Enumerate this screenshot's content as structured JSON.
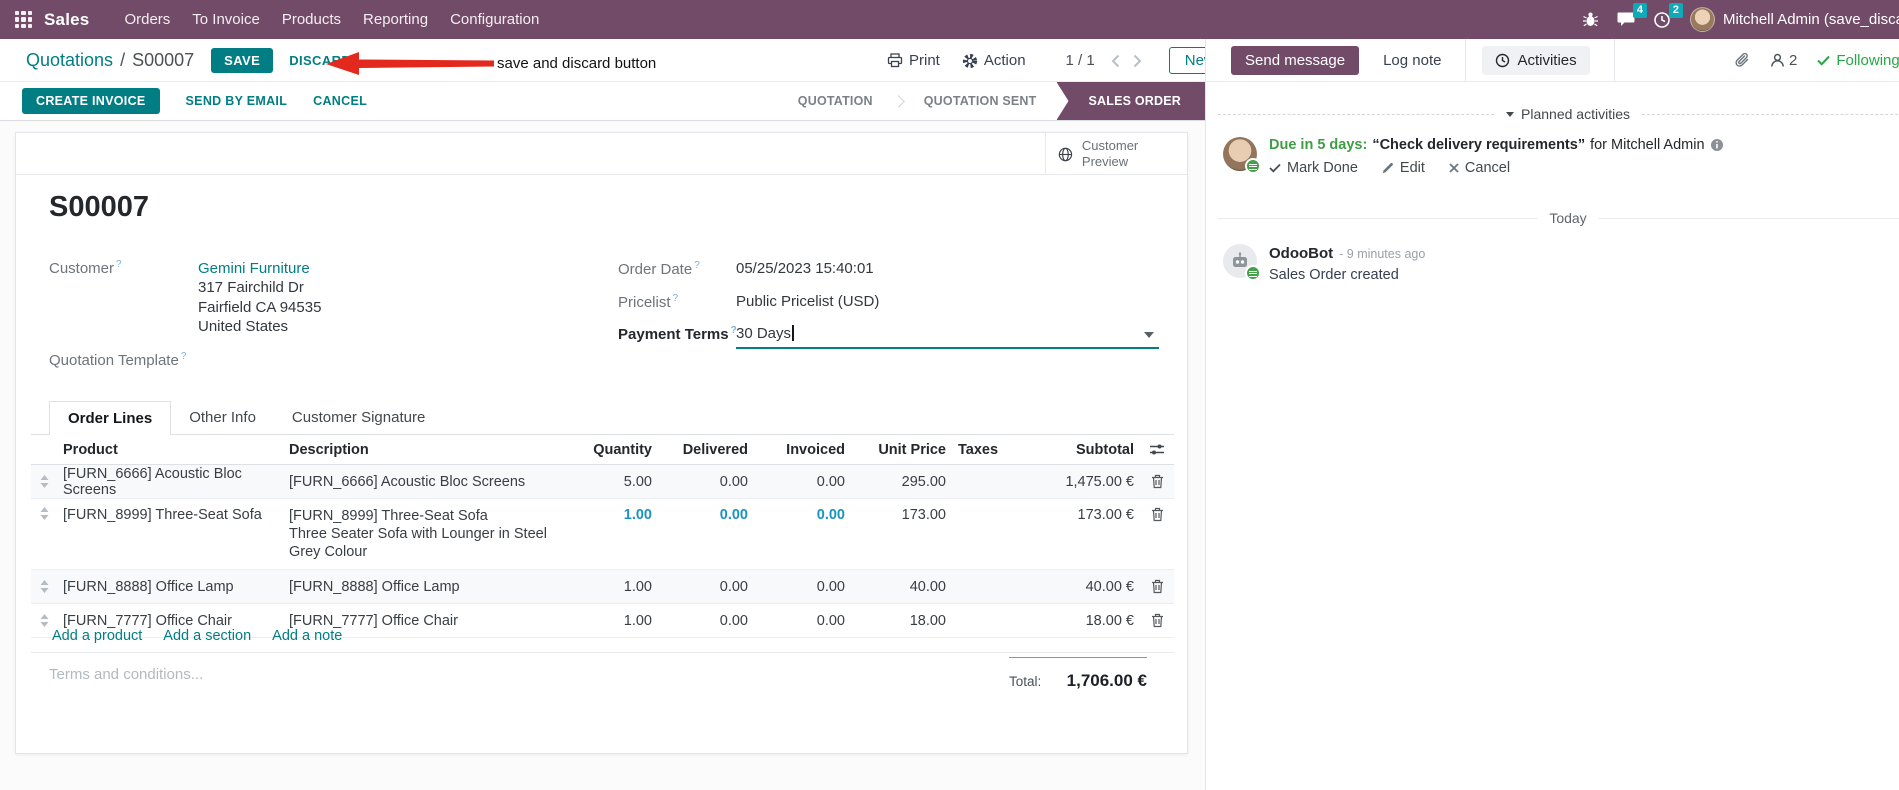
{
  "colors": {
    "brand": "#714B67",
    "accent": "#017E84",
    "badge": "#0dabb8",
    "green": "#28a745",
    "modified": "#1a93c1",
    "annotation_red": "#e3291d"
  },
  "topnav": {
    "app_label": "Sales",
    "menus": [
      "Orders",
      "To Invoice",
      "Products",
      "Reporting",
      "Configuration"
    ],
    "chat_badge": "4",
    "clock_badge": "2",
    "user_name": "Mitchell Admin (save_discard"
  },
  "breadcrumb": {
    "parent": "Quotations",
    "separator": "/",
    "current": "S00007",
    "save": "SAVE",
    "discard": "DISCARD",
    "annotation": "save and discard button",
    "print": "Print",
    "action": "Action",
    "pager": "1 / 1",
    "new": "New"
  },
  "statusbar": {
    "create_invoice": "CREATE INVOICE",
    "send_by_email": "SEND BY EMAIL",
    "cancel": "CANCEL",
    "stages": [
      "QUOTATION",
      "QUOTATION SENT",
      "SALES ORDER"
    ]
  },
  "sheet": {
    "customer_preview": "Customer Preview",
    "title": "S00007",
    "customer_label": "Customer",
    "customer_name": "Gemini Furniture",
    "address_line1": "317 Fairchild Dr",
    "address_line2": "Fairfield CA 94535",
    "address_line3": "United States",
    "quotation_template_label": "Quotation Template",
    "order_date_label": "Order Date",
    "order_date_value": "05/25/2023 15:40:01",
    "pricelist_label": "Pricelist",
    "pricelist_value": "Public Pricelist (USD)",
    "payment_terms_label": "Payment Terms",
    "payment_terms_value": "30 Days",
    "tabs": [
      "Order Lines",
      "Other Info",
      "Customer Signature"
    ],
    "table": {
      "columns": {
        "product": "Product",
        "description": "Description",
        "quantity": "Quantity",
        "delivered": "Delivered",
        "invoiced": "Invoiced",
        "unit_price": "Unit Price",
        "taxes": "Taxes",
        "subtotal": "Subtotal"
      },
      "rows": [
        {
          "product": "[FURN_6666] Acoustic Bloc Screens",
          "description": "[FURN_6666] Acoustic Bloc Screens",
          "description2": "",
          "quantity": "5.00",
          "delivered": "0.00",
          "invoiced": "0.00",
          "unit_price": "295.00",
          "taxes": "",
          "subtotal": "1,475.00 €"
        },
        {
          "product": "[FURN_8999] Three-Seat Sofa",
          "description": "[FURN_8999] Three-Seat Sofa",
          "description2": "Three Seater Sofa with Lounger in Steel Grey Colour",
          "quantity": "1.00",
          "delivered": "0.00",
          "invoiced": "0.00",
          "unit_price": "173.00",
          "taxes": "",
          "subtotal": "173.00 €"
        },
        {
          "product": "[FURN_8888] Office Lamp",
          "description": "[FURN_8888] Office Lamp",
          "description2": "",
          "quantity": "1.00",
          "delivered": "0.00",
          "invoiced": "0.00",
          "unit_price": "40.00",
          "taxes": "",
          "subtotal": "40.00 €"
        },
        {
          "product": "[FURN_7777] Office Chair",
          "description": "[FURN_7777] Office Chair",
          "description2": "",
          "quantity": "1.00",
          "delivered": "0.00",
          "invoiced": "0.00",
          "unit_price": "18.00",
          "taxes": "",
          "subtotal": "18.00 €"
        }
      ],
      "add_product": "Add a product",
      "add_section": "Add a section",
      "add_note": "Add a note"
    },
    "terms_placeholder": "Terms and conditions...",
    "total_label": "Total:",
    "total_value": "1,706.00 €"
  },
  "chatter": {
    "send_message": "Send message",
    "log_note": "Log note",
    "activities": "Activities",
    "followers_count": "2",
    "following": "Following",
    "planned_activities": "Planned activities",
    "activity": {
      "due": "Due in 5 days:",
      "summary": "“Check delivery requirements”",
      "assignee": "for Mitchell Admin",
      "mark_done": "Mark Done",
      "edit": "Edit",
      "cancel": "Cancel"
    },
    "today": "Today",
    "message": {
      "author": "OdooBot",
      "time": "- 9 minutes ago",
      "body": "Sales Order created"
    }
  }
}
